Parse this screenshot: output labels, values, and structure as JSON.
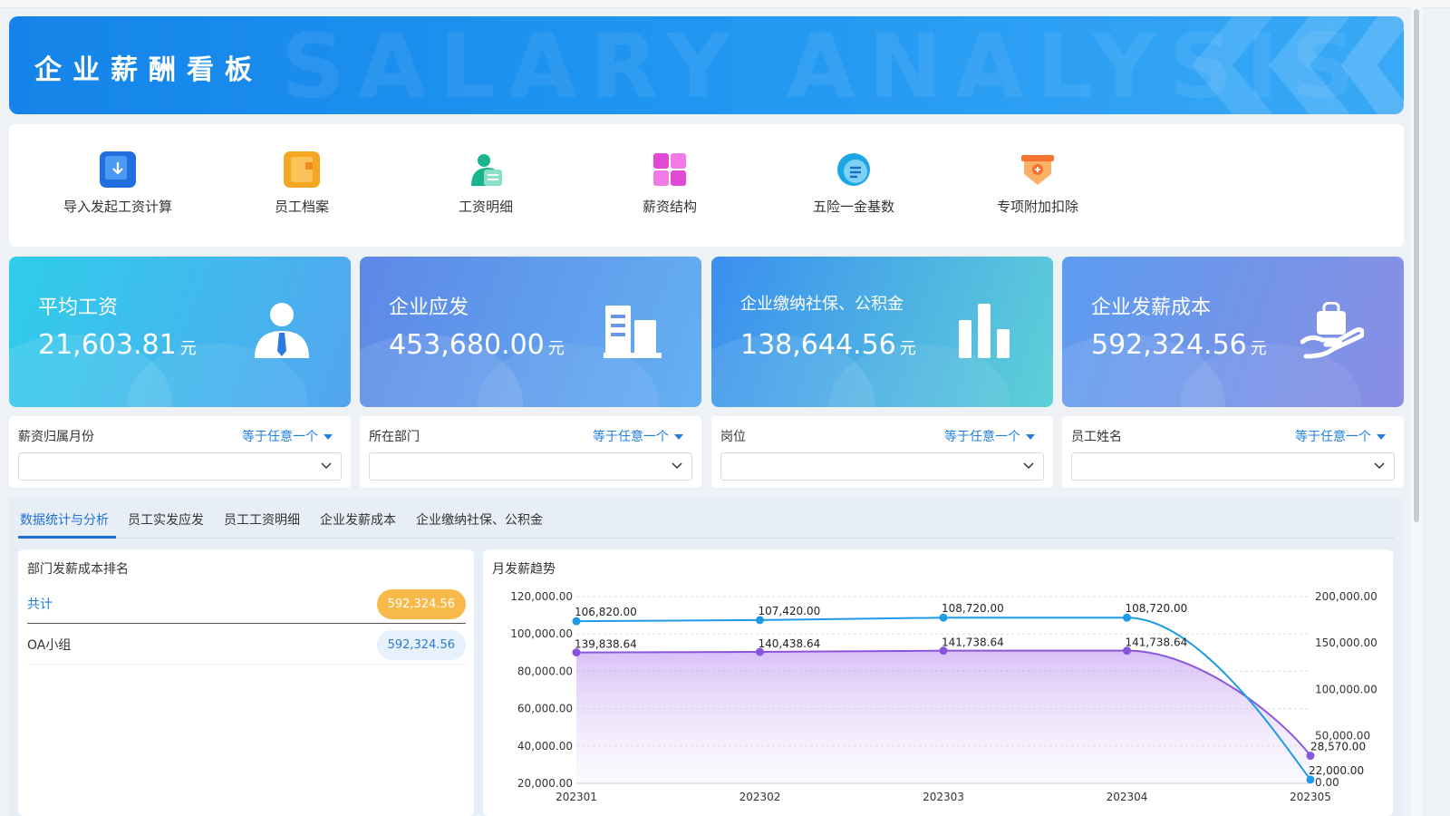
{
  "banner": {
    "title": "企业薪酬看板",
    "watermark": "SALARY ANALYSIS"
  },
  "shortcuts": [
    {
      "label": "导入发起工资计算",
      "icon": "import-icon",
      "color": "#1f6fe0"
    },
    {
      "label": "员工档案",
      "icon": "folder-icon",
      "color": "#f5a623"
    },
    {
      "label": "工资明细",
      "icon": "user-list-icon",
      "color": "#19b48e"
    },
    {
      "label": "薪资结构",
      "icon": "grid-icon",
      "color": "#e04ad6"
    },
    {
      "label": "五险一金基数",
      "icon": "chat-list-icon",
      "color": "#1ba7e6"
    },
    {
      "label": "专项附加扣除",
      "icon": "deduct-icon",
      "color": "#f5732e"
    }
  ],
  "kpis": [
    {
      "title": "平均工资",
      "value": "21,603.81",
      "unit": "元",
      "icon": "employee-icon"
    },
    {
      "title": "企业应发",
      "value": "453,680.00",
      "unit": "元",
      "icon": "building-icon"
    },
    {
      "title": "企业缴纳社保、公积金",
      "value": "138,644.56",
      "unit": "元",
      "icon": "bar-chart-icon"
    },
    {
      "title": "企业发薪成本",
      "value": "592,324.56",
      "unit": "元",
      "icon": "hand-bag-icon"
    }
  ],
  "filters": [
    {
      "label": "薪资归属月份",
      "op": "等于任意一个",
      "value": ""
    },
    {
      "label": "所在部门",
      "op": "等于任意一个",
      "value": ""
    },
    {
      "label": "岗位",
      "op": "等于任意一个",
      "value": ""
    },
    {
      "label": "员工姓名",
      "op": "等于任意一个",
      "value": ""
    }
  ],
  "tabs": [
    "数据统计与分析",
    "员工实发应发",
    "员工工资明细",
    "企业发薪成本",
    "企业缴纳社保、公积金"
  ],
  "active_tab": 0,
  "ranking": {
    "title": "部门发薪成本排名",
    "total_label": "共计",
    "total_value": "592,324.56",
    "rows": [
      {
        "name": "OA小组",
        "value": "592,324.56"
      }
    ]
  },
  "colors": {
    "accent": "#1f6fd6",
    "total_pill": "#f7b94a",
    "row_pill": "#e6f1fb",
    "line1": "#1f9be6",
    "line2": "#8a55dd"
  },
  "chart_data": {
    "type": "line",
    "title": "月发薪趋势",
    "x": [
      "202301",
      "202302",
      "202303",
      "202304",
      "202305"
    ],
    "series": [
      {
        "name": "",
        "axis": "left",
        "values": [
          106820.0,
          107420.0,
          108720.0,
          108720.0,
          22000.0
        ]
      },
      {
        "name": "",
        "axis": "right",
        "values": [
          139838.64,
          140438.64,
          141738.64,
          141738.64,
          28570.0
        ]
      }
    ],
    "labels_left": [
      "106,820.00",
      "107,420.00",
      "108,720.00",
      "108,720.00",
      "22,000.00"
    ],
    "labels_right": [
      "139,838.64",
      "140,438.64",
      "141,738.64",
      "141,738.64",
      "28,570.00"
    ],
    "y_left": {
      "ticks": [
        "120,000.00",
        "100,000.00",
        "80,000.00",
        "60,000.00",
        "40,000.00",
        "20,000.00"
      ],
      "range": [
        0,
        120000
      ]
    },
    "y_right": {
      "ticks": [
        "200,000.00",
        "150,000.00",
        "100,000.00",
        "50,000.00",
        "0.00"
      ],
      "range": [
        0,
        200000
      ]
    },
    "grid": true
  }
}
